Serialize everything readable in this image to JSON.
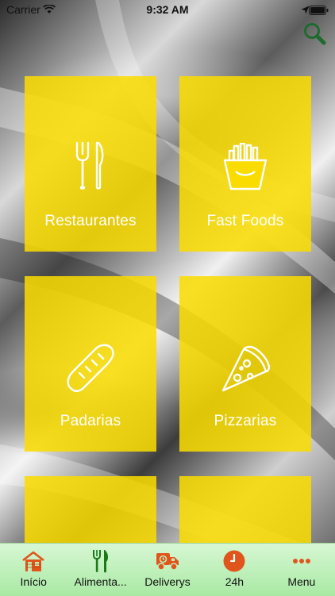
{
  "status_bar": {
    "carrier": "Carrier",
    "time": "9:32 AM"
  },
  "search": {
    "icon": "search-icon",
    "color": "#1e6b2e"
  },
  "tiles": [
    {
      "label": "Restaurantes",
      "icon": "fork-knife-icon"
    },
    {
      "label": "Fast Foods",
      "icon": "fries-icon"
    },
    {
      "label": "Padarias",
      "icon": "bread-icon"
    },
    {
      "label": "Pizzarias",
      "icon": "pizza-slice-icon"
    },
    {
      "label": "",
      "icon": ""
    },
    {
      "label": "",
      "icon": ""
    }
  ],
  "tabbar": {
    "items": [
      {
        "label": "Início",
        "icon": "house-icon",
        "color": "#e0551c"
      },
      {
        "label": "Alimenta...",
        "icon": "fork-knife-icon",
        "color": "#1a7a1a"
      },
      {
        "label": "Deliverys",
        "icon": "delivery-truck-icon",
        "color": "#e0551c"
      },
      {
        "label": "24h",
        "icon": "clock-icon",
        "color": "#e0551c"
      },
      {
        "label": "Menu",
        "icon": "more-dots-icon",
        "color": "#e0551c"
      }
    ]
  },
  "colors": {
    "tile_yellow": "#fadc00",
    "tabbar_green": "#bff0ba",
    "accent_orange": "#e0551c"
  }
}
